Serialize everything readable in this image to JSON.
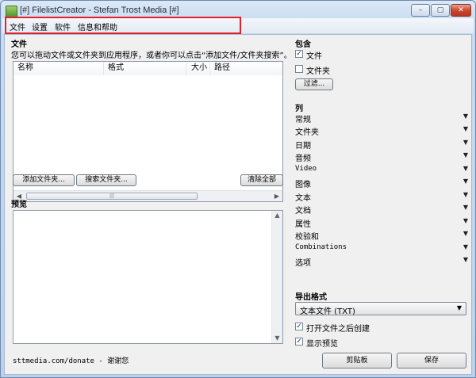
{
  "window": {
    "title": "[#] FilelistCreator - Stefan Trost Media [#]",
    "controls": {
      "minimize": "–",
      "maximize": "▢",
      "close": "✕"
    }
  },
  "menu": [
    "文件",
    "设置",
    "软件",
    "信息和帮助"
  ],
  "files": {
    "heading": "文件",
    "hint": "您可以拖动文件或文件夹到应用程序，或者你可以点击“添加文件/文件夹搜索”。",
    "columns": [
      "名称",
      "格式",
      "大小",
      "路径"
    ],
    "scroll_thumb": "|||",
    "buttons": {
      "add_folder": "添加文件夹...",
      "search_folder": "搜索文件夹...",
      "clear_all": "清除全部"
    }
  },
  "preview": {
    "heading": "预览"
  },
  "include": {
    "heading": "包含",
    "files": {
      "label": "文件",
      "checked": true
    },
    "folders": {
      "label": "文件夹",
      "checked": false
    },
    "filter_button": "过滤..."
  },
  "columns_panel": {
    "heading": "列",
    "items": [
      "常规",
      "文件夹",
      "日期",
      "音频",
      "Video",
      "图像",
      "文本",
      "文档",
      "属性",
      "校验和",
      "Combinations",
      "选项"
    ]
  },
  "export": {
    "heading": "导出格式",
    "format": "文本文件 (TXT)",
    "open_after_create": {
      "label": "打开文件之后创建",
      "checked": true
    },
    "show_preview": {
      "label": "显示预览",
      "checked": true
    },
    "clipboard_button": "剪贴板",
    "save_button": "保存"
  },
  "footer": {
    "link": "sttmedia.com/donate - 谢谢您"
  },
  "colors": {
    "highlight_border": "#e5202a",
    "title_bar": "#c7daf0"
  },
  "icons": [
    "app-icon",
    "chevron-down-icon",
    "checkmark-icon"
  ]
}
